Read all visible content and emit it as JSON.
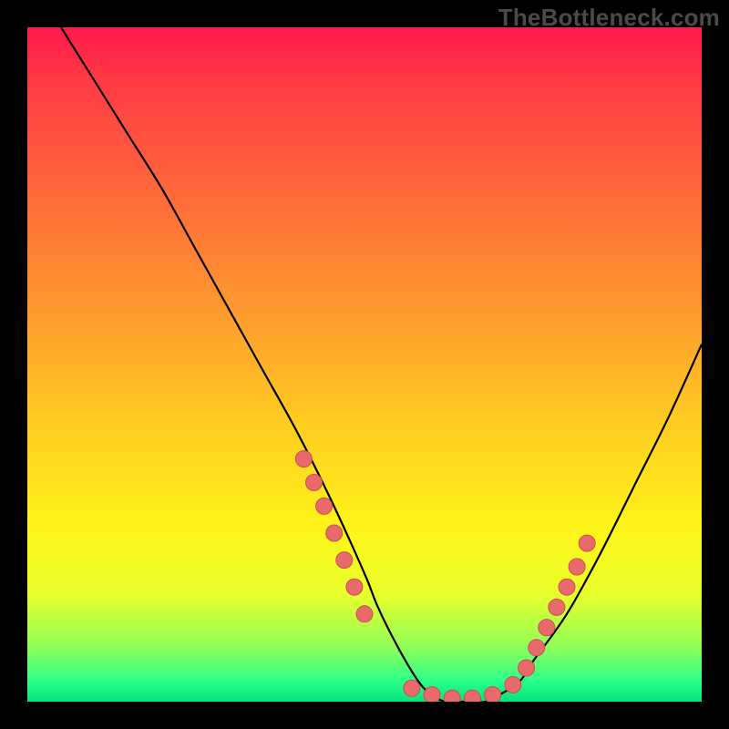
{
  "watermark": "TheBottleneck.com",
  "colors": {
    "curve_stroke": "#000000",
    "dot_fill": "#e86a6a",
    "dot_stroke": "#c94f4f"
  },
  "chart_data": {
    "type": "line",
    "title": "",
    "xlabel": "",
    "ylabel": "",
    "xlim": [
      0,
      100
    ],
    "ylim": [
      0,
      100
    ],
    "grid": false,
    "series": [
      {
        "name": "bottleneck-curve",
        "x": [
          5,
          10,
          15,
          20,
          25,
          30,
          35,
          40,
          45,
          50,
          52,
          55,
          58,
          60,
          62,
          65,
          68,
          70,
          73,
          75,
          80,
          85,
          90,
          95,
          100
        ],
        "y": [
          100,
          92,
          84,
          76,
          67,
          58,
          49,
          40,
          30,
          19,
          14,
          8,
          3,
          1,
          0,
          0,
          0,
          1,
          3,
          6,
          13,
          22,
          32,
          42,
          53
        ]
      }
    ],
    "dots_left": [
      [
        41,
        36
      ],
      [
        42.5,
        32.5
      ],
      [
        44,
        29
      ],
      [
        45.5,
        25
      ],
      [
        47,
        21
      ],
      [
        48.5,
        17
      ],
      [
        50,
        13
      ]
    ],
    "dots_bottom": [
      [
        57,
        2
      ],
      [
        60,
        1
      ],
      [
        63,
        0.5
      ],
      [
        66,
        0.5
      ],
      [
        69,
        1
      ],
      [
        72,
        2.5
      ]
    ],
    "dots_right": [
      [
        74,
        5
      ],
      [
        75.5,
        8
      ],
      [
        77,
        11
      ],
      [
        78.5,
        14
      ],
      [
        80,
        17
      ],
      [
        81.5,
        20
      ],
      [
        83,
        23.5
      ]
    ]
  }
}
